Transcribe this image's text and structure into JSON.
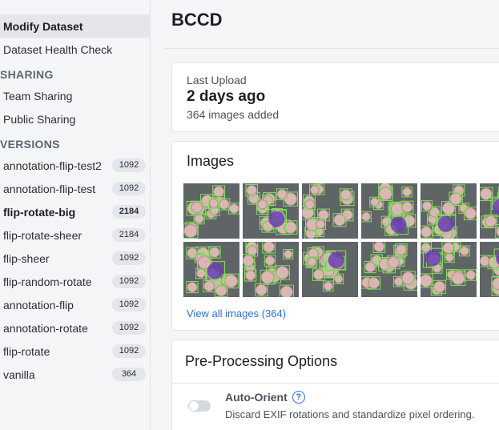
{
  "sidebar": {
    "nav_items": [
      {
        "label": "Modify Dataset",
        "active": true
      },
      {
        "label": "Dataset Health Check",
        "active": false
      }
    ],
    "sharing": {
      "title": "SHARING",
      "items": [
        "Team Sharing",
        "Public Sharing"
      ]
    },
    "versions": {
      "title": "VERSIONS",
      "items": [
        {
          "name": "annotation-flip-test2",
          "count": "1092"
        },
        {
          "name": "annotation-flip-test",
          "count": "1092"
        },
        {
          "name": "flip-rotate-big",
          "count": "2184"
        },
        {
          "name": "flip-rotate-sheer",
          "count": "2184"
        },
        {
          "name": "flip-sheer",
          "count": "1092"
        },
        {
          "name": "flip-random-rotate",
          "count": "1092"
        },
        {
          "name": "annotation-flip",
          "count": "1092"
        },
        {
          "name": "annotation-rotate",
          "count": "1092"
        },
        {
          "name": "flip-rotate",
          "count": "1092"
        },
        {
          "name": "vanilla",
          "count": "364"
        }
      ]
    }
  },
  "main": {
    "title": "BCCD",
    "upload": {
      "label": "Last Upload",
      "value": "2 days ago",
      "sub": "364 images added"
    },
    "images": {
      "title": "Images",
      "view_all": "View all images (364)"
    },
    "preprocessing": {
      "title": "Pre-Processing Options",
      "option_title": "Auto-Orient",
      "option_help": "?",
      "option_desc": "Discard EXIF rotations and standardize pixel ordering."
    }
  },
  "colors": {
    "accent": "#2f6fd1",
    "box_green": "#7ee35a",
    "cell_purple": "#6a3fb0"
  }
}
